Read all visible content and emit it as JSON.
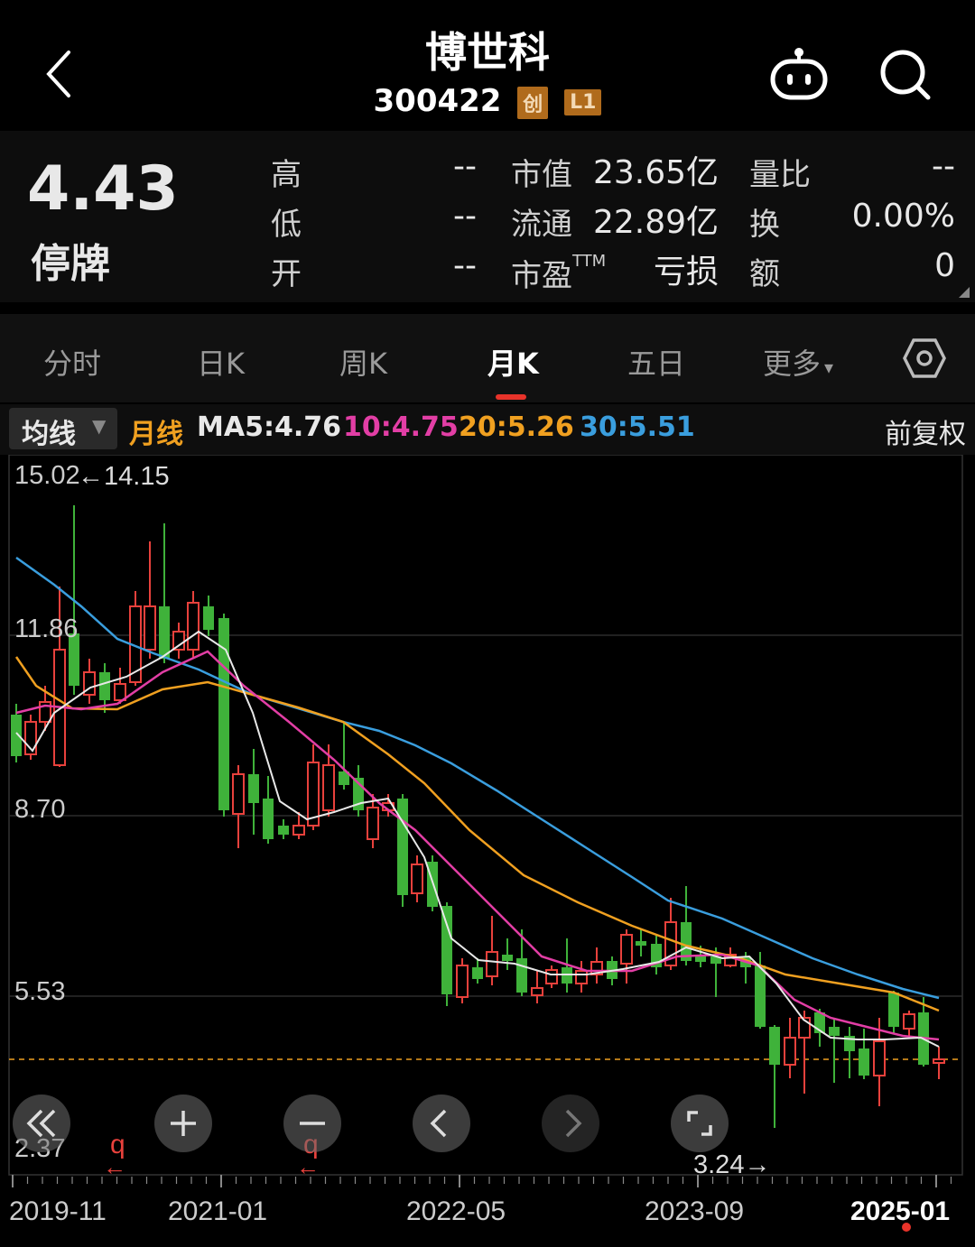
{
  "header": {
    "title": "博世科",
    "code": "300422",
    "tag_board": "创",
    "tag_level": "L1"
  },
  "quote": {
    "price": "4.43",
    "status": "停牌",
    "rows": [
      {
        "l1": "高",
        "v1": "--",
        "l2": "市值",
        "v2": "23.65亿",
        "l3": "量比",
        "v3": "--"
      },
      {
        "l1": "低",
        "v1": "--",
        "l2": "流通",
        "v2": "22.89亿",
        "l3": "换",
        "v3": "0.00%"
      },
      {
        "l1": "开",
        "v1": "--",
        "l2": "市盈",
        "l2sup": "TTM",
        "v2": "亏损",
        "l3": "额",
        "v3": "0"
      }
    ]
  },
  "tabs": [
    {
      "label": "分时",
      "active": false
    },
    {
      "label": "日K",
      "active": false
    },
    {
      "label": "周K",
      "active": false
    },
    {
      "label": "月K",
      "active": true
    },
    {
      "label": "五日",
      "active": false
    },
    {
      "label": "更多",
      "active": false
    }
  ],
  "ma_row": {
    "dropdown": "均线",
    "period": "月线",
    "ma5": "MA5:4.76",
    "ma10": "10:4.75",
    "ma20": "20:5.26",
    "ma30": "30:5.51",
    "adjust": "前复权",
    "colors": {
      "ma5": "#e8e8e8",
      "ma10": "#e23ea5",
      "ma20": "#f0a020",
      "ma30": "#3a9ede",
      "up": "#e8413c",
      "down": "#3fb23a",
      "period": "#f0a020"
    }
  },
  "chart_data": {
    "type": "candlestick",
    "y_ticks": [
      "15.02",
      "11.86",
      "8.70",
      "5.53",
      "2.37"
    ],
    "x_ticks": [
      "2019-11",
      "2021-01",
      "2022-05",
      "2023-09",
      "2025-01"
    ],
    "max_label": "14.15",
    "min_label": "3.24",
    "last_price": 4.43,
    "ylim": [
      2.37,
      15.02
    ]
  },
  "controls": [
    "rewind-icon",
    "zoom-in-icon",
    "zoom-out-icon",
    "prev-icon",
    "next-icon",
    "fullscreen-icon"
  ]
}
